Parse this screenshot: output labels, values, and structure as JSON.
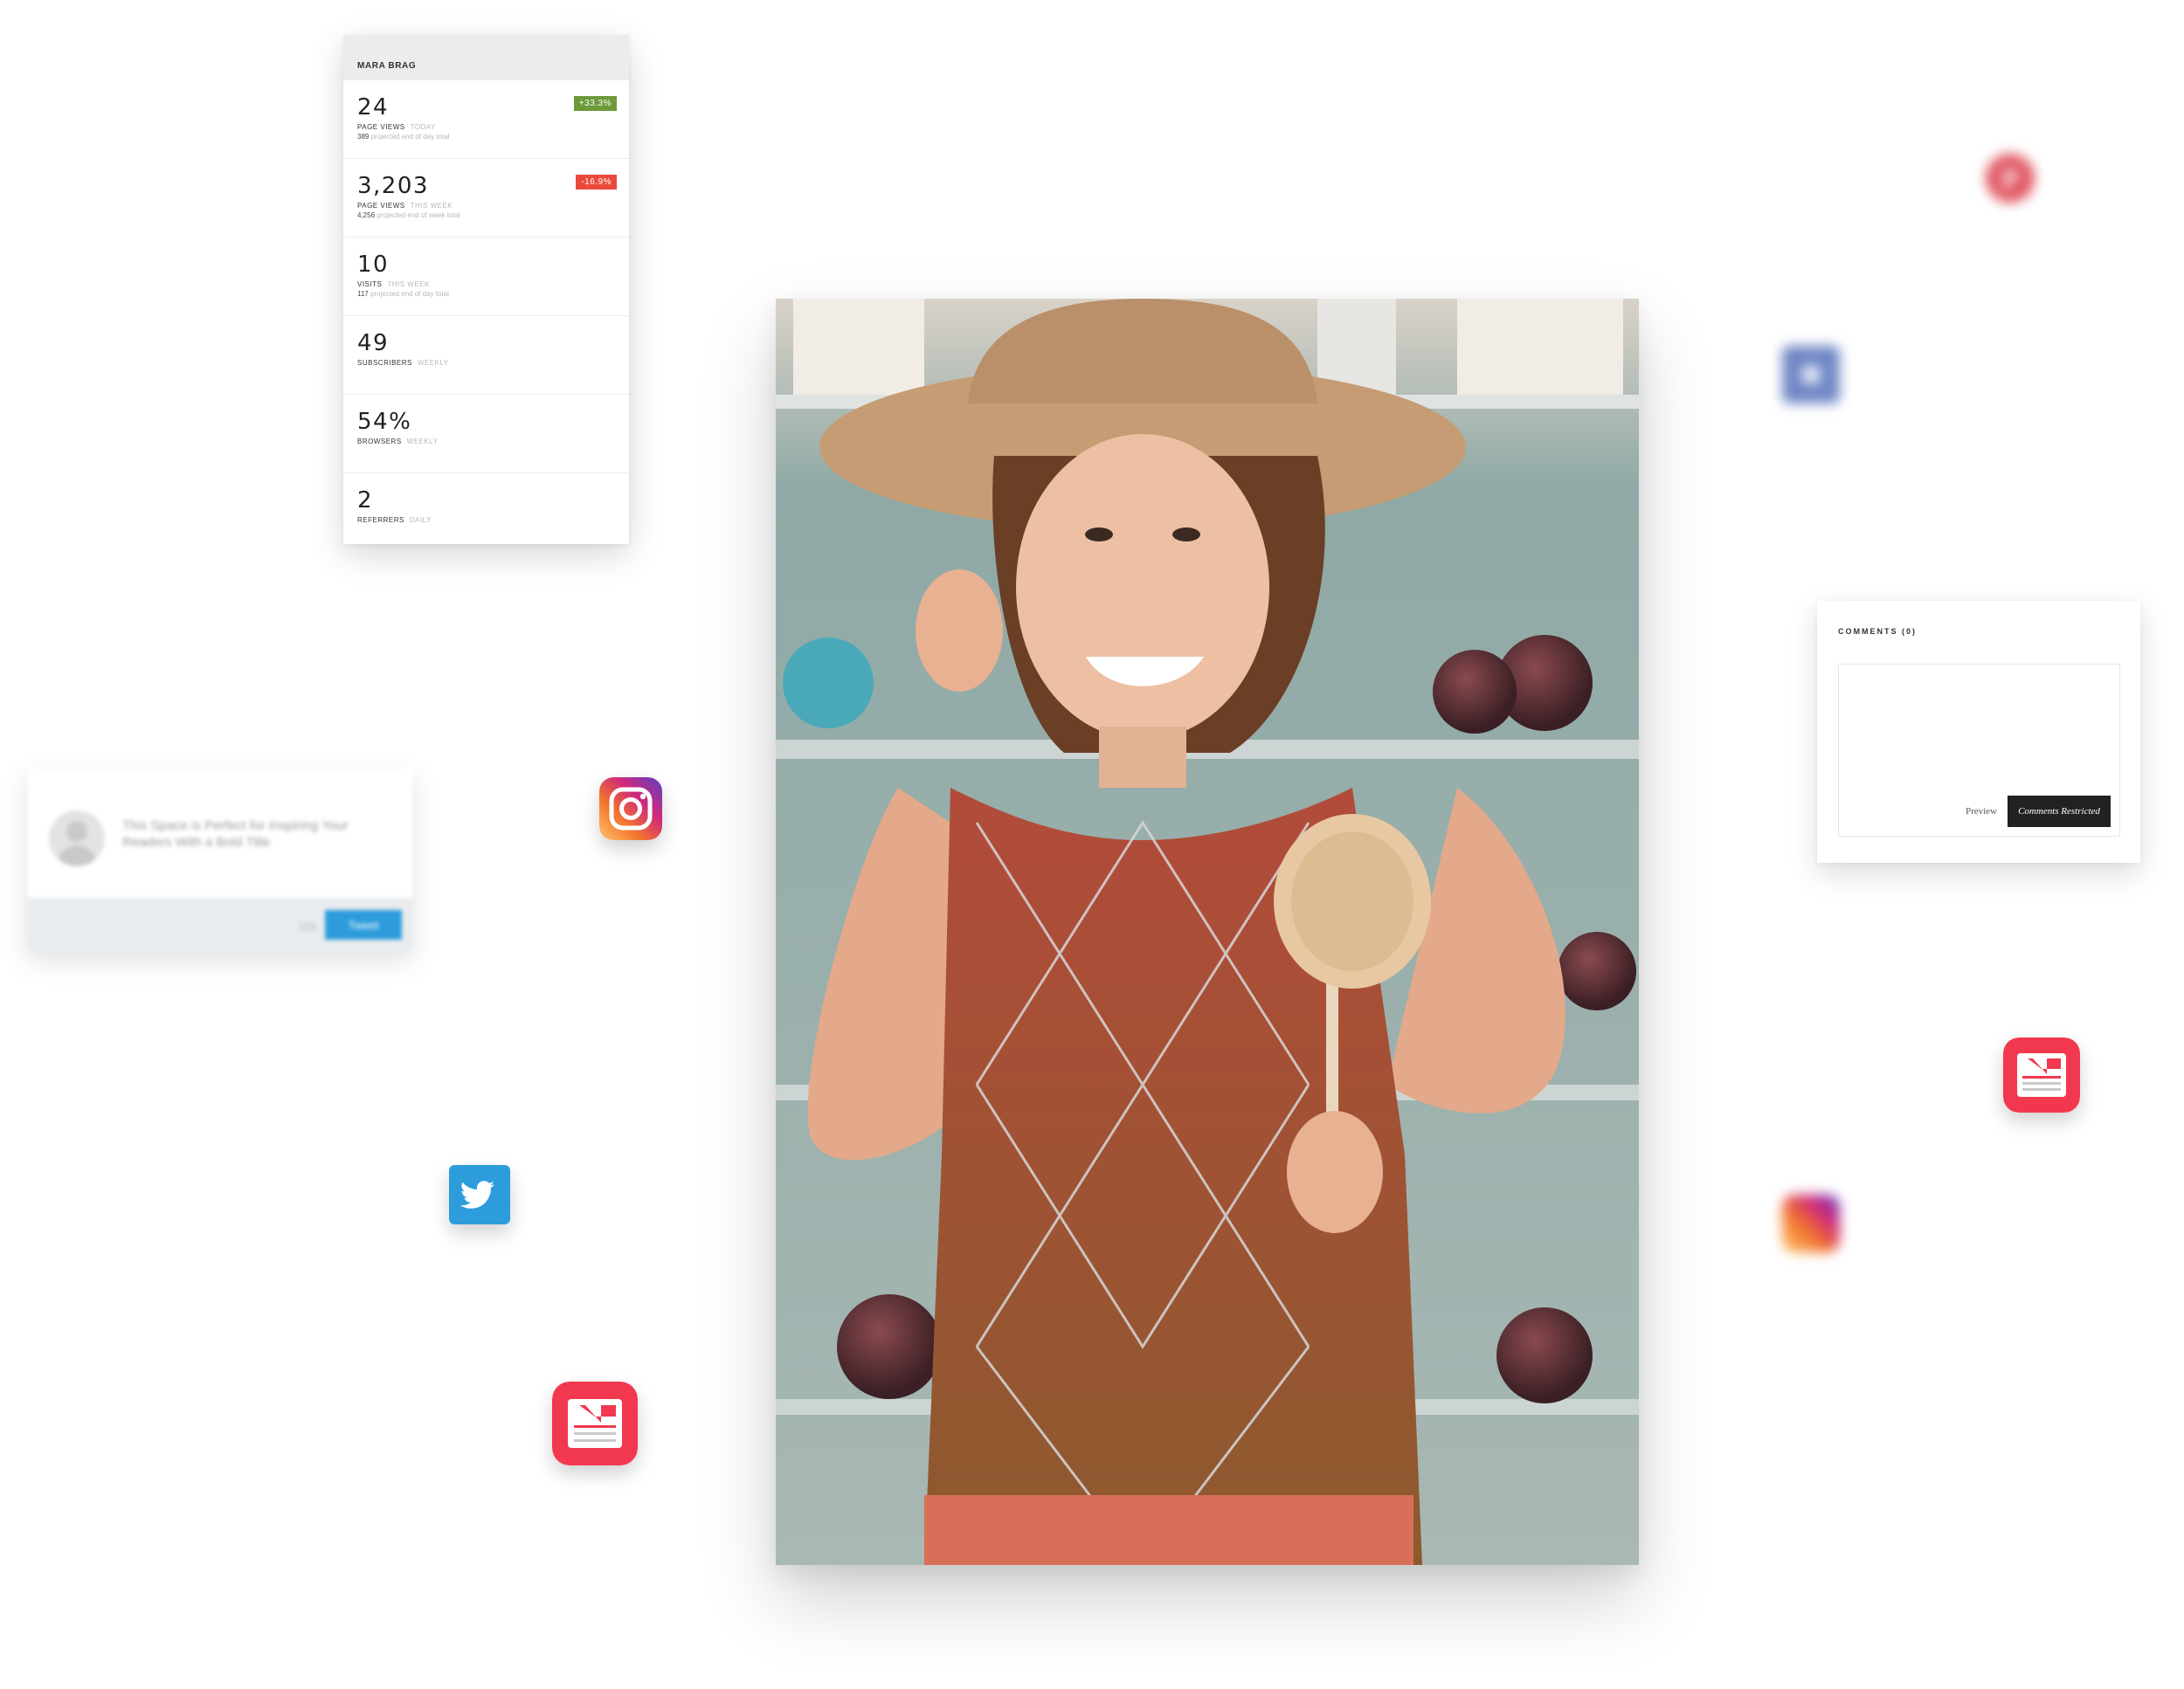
{
  "stats": {
    "site_name": "MARA BRAG",
    "rows": [
      {
        "value": "24",
        "label": "PAGE VIEWS",
        "period": "TODAY",
        "projection_value": "389",
        "projection_text": "projected end of day total",
        "badge": "+33.3%"
      },
      {
        "value": "3,203",
        "label": "PAGE VIEWS",
        "period": "THIS WEEK",
        "projection_value": "4,256",
        "projection_text": "projected end of week total",
        "badge": "-16.9%"
      },
      {
        "value": "10",
        "label": "VISITS",
        "period": "THIS WEEK",
        "projection_value": "117",
        "projection_text": "projected end of day total"
      },
      {
        "value": "49",
        "label": "SUBSCRIBERS",
        "period": "WEEKLY"
      },
      {
        "value": "54%",
        "label": "BROWSERS",
        "period": "WEEKLY"
      },
      {
        "value": "2",
        "label": "REFERRERS",
        "period": "DAILY"
      }
    ],
    "colors": {
      "badge_up": "#6c9a3a",
      "badge_down": "#ea4a3c"
    }
  },
  "comments": {
    "title": "COMMENTS (0)",
    "preview_label": "Preview",
    "restricted_label": "Comments Restricted"
  },
  "tweet": {
    "text": "This Space is Perfect for Inspiring Your Readers With a Bold Title",
    "count": "116",
    "button_label": "Tweet",
    "accent": "#2d9cdb"
  },
  "icons": [
    "pinterest-icon",
    "squarespace-icon",
    "instagram-icon",
    "apple-news-icon",
    "twitter-icon"
  ]
}
